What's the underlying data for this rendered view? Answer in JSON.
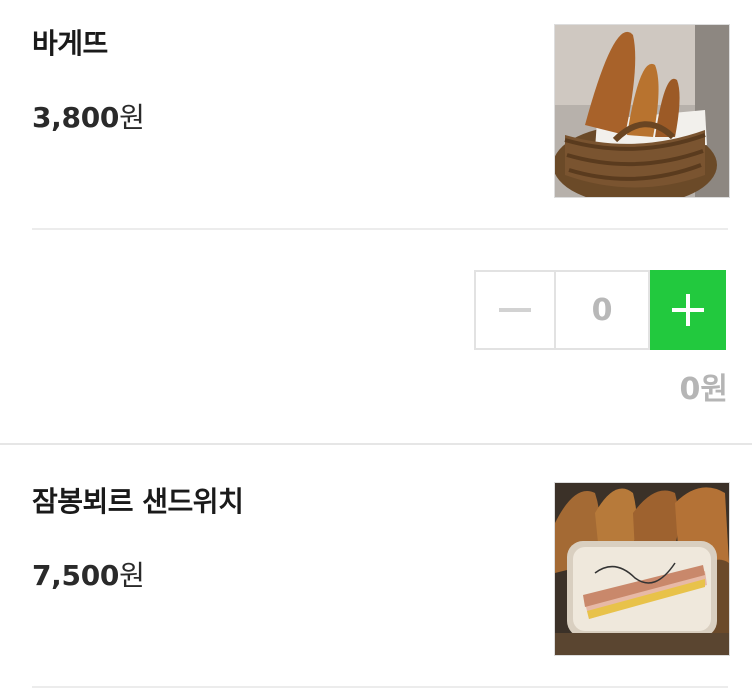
{
  "products": [
    {
      "name": "바게뜨",
      "price": "3,800",
      "currency": "원",
      "image_icon": "baguette-basket-photo"
    },
    {
      "name": "잠봉뵈르 샌드위치",
      "price": "7,500",
      "currency": "원",
      "image_icon": "jambon-beurre-sandwich-photo"
    }
  ],
  "quantity": {
    "value": "0",
    "minus_icon": "minus-icon",
    "plus_icon": "plus-icon",
    "accent": "#22c93e"
  },
  "subtotal": "0원"
}
